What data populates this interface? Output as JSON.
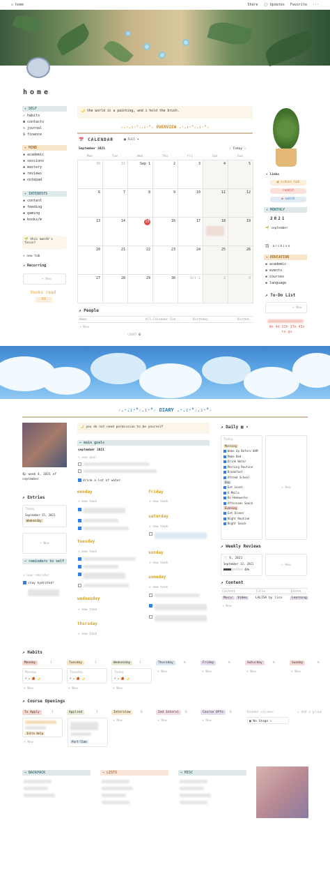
{
  "topbar": {
    "page": "home",
    "share": "Share",
    "updates": "Updates",
    "favorite": "Favorite"
  },
  "title": "home",
  "sidebar": {
    "self": {
      "header": "SELF",
      "items": [
        "habits",
        "contacts",
        "journal",
        "finance"
      ]
    },
    "mind": {
      "header": "MIND",
      "items": [
        "academic",
        "sessions",
        "mastery",
        "reviews",
        "notepad"
      ]
    },
    "interests": {
      "header": "INTERESTS",
      "items": [
        "content",
        "feeding",
        "gaming",
        "books/m"
      ]
    },
    "focus": "this month's focus?",
    "newtab": "+ new tab",
    "recurring": "Recurring",
    "new": "+ New",
    "books": "books read",
    "books_count": "01"
  },
  "quote1": "the world is a painting, and i hold the brush.",
  "overview": "☆.·.:·°☆.:·°☆ OVERVIEW .·.:·°☆.:·°☆",
  "calendar": {
    "title": "CALENDAR",
    "view": "Full",
    "month": "September 2021",
    "today_btn": "Today",
    "days": [
      "Mon",
      "Tue",
      "Wed",
      "Thu",
      "Fri",
      "Sat",
      "Sun"
    ],
    "weeks": [
      [
        "30",
        "31",
        "Sep 1",
        "2",
        "3",
        "4",
        "5"
      ],
      [
        "6",
        "7",
        "8",
        "9",
        "10",
        "11",
        "12"
      ],
      [
        "13",
        "14",
        "15",
        "16",
        "17",
        "18",
        "19"
      ],
      [
        "20",
        "21",
        "22",
        "23",
        "24",
        "25",
        "26"
      ],
      [
        "27",
        "28",
        "29",
        "30",
        "Oct 1",
        "2",
        "3"
      ]
    ],
    "today_day": "15"
  },
  "people": {
    "title": "People",
    "cols": [
      "Name",
      "All Calendar Eve..",
      "Birthday",
      "Birthd"
    ],
    "new": "+ New",
    "count_label": "COUNT",
    "count": "0"
  },
  "right": {
    "links": "links",
    "school_hub": "school hub",
    "reddit": "reddit",
    "watch": "watch",
    "monthly": "MONTHLY",
    "year": "2021",
    "september": "september",
    "archive": "archive",
    "education": "EDUCATION",
    "edu_items": [
      "academic",
      "events",
      "courses",
      "language"
    ],
    "todo": "To-Do List",
    "new": "+ New",
    "countdown": "9m 4d 23h 37m 43s to go"
  },
  "diary": {
    "title": "☆.·.:·°☆.:·°☆ DIARY .·.:·°☆.:·°☆",
    "quote": "you do not need permission to be yourself",
    "week": "week 4, 2021 of september",
    "entries": "Entries",
    "entry_card": "Today",
    "entry_date": "September 15, 2021",
    "entry_tag": "Wednesday",
    "new": "+ New",
    "reminders": "reminders to self",
    "new_reminder": "+ new reminder",
    "reminder_item": "stay hydrated!",
    "goals": "main goals",
    "goals_month": "september 2021",
    "new_goal": "+ new goal",
    "goal_item": "drink a lot of water",
    "days": [
      "monday",
      "tuesday",
      "wednesday",
      "thursday",
      "friday",
      "saturday",
      "sunday",
      "someday"
    ],
    "new_task": "+ new task"
  },
  "daily": {
    "title": "Daily",
    "card_title": "Today",
    "morning": "Morning",
    "morning_items": [
      "Wake Up Before 8AM",
      "Make Bed",
      "Drink Water",
      "Morning Routine",
      "Breakfast",
      "Attend School"
    ],
    "day": "Day",
    "day_items": [
      "Eat Lunch",
      "E-Mails",
      "Do Homeworks",
      "Afternoon Snack"
    ],
    "evening": "Evening",
    "evening_items": [
      "Eat Dinner",
      "Night Routine",
      "Night Snack"
    ]
  },
  "weekly": {
    "title": "Weekly Reviews",
    "card": "6, 2021",
    "date": "September 12, 2021",
    "progress": 0.4,
    "progress_label": "40%",
    "new": "+ New"
  },
  "content": {
    "title": "Content",
    "cols": [
      "Content",
      "Title",
      "Intent"
    ],
    "tags": [
      "Music",
      "Video"
    ],
    "item_title": "LALISA by lisa",
    "intent": "Learning",
    "new": "+ New"
  },
  "habits": {
    "title": "Habits",
    "cols": [
      {
        "name": "Monday",
        "count": "1",
        "color": "#f6d6cd"
      },
      {
        "name": "Tuesday",
        "count": "1",
        "color": "#f7e7c8"
      },
      {
        "name": "Wednesday",
        "count": "1",
        "color": "#e7ecd6"
      },
      {
        "name": "Thursday",
        "count": "0",
        "color": "#dbe6f1"
      },
      {
        "name": "Friday",
        "count": "0",
        "color": "#e6ddef"
      },
      {
        "name": "Saturday",
        "count": "0",
        "color": "#f3dbe3"
      },
      {
        "name": "Sunday",
        "count": "0",
        "color": "#f6d8d5"
      }
    ],
    "cards": [
      "Monday",
      "Tuesday",
      "Today"
    ],
    "new": "+ New"
  },
  "courses": {
    "title": "Course Openings",
    "cols": [
      {
        "name": "To Apply",
        "count": "1",
        "color": "#f6d6cd"
      },
      {
        "name": "Applied",
        "count": "1",
        "color": "#e7ecd6"
      },
      {
        "name": "Interview",
        "count": "0",
        "color": "#f7e7c8"
      },
      {
        "name": "2nd Intervi",
        "count": "0",
        "color": "#f3dbe3"
      },
      {
        "name": "Course Offe",
        "count": "0",
        "color": "#e6ddef"
      }
    ],
    "hidden": "Hidden columns",
    "nostage": "No Stage",
    "nostage_count": "0",
    "add_group": "+ Add a group",
    "tag1": "Intro Help",
    "tag2": "Part-Time",
    "new": "+ New"
  },
  "bottom": {
    "backpack": "BACKPACK",
    "lists": "LISTS",
    "misc": "MISC"
  }
}
